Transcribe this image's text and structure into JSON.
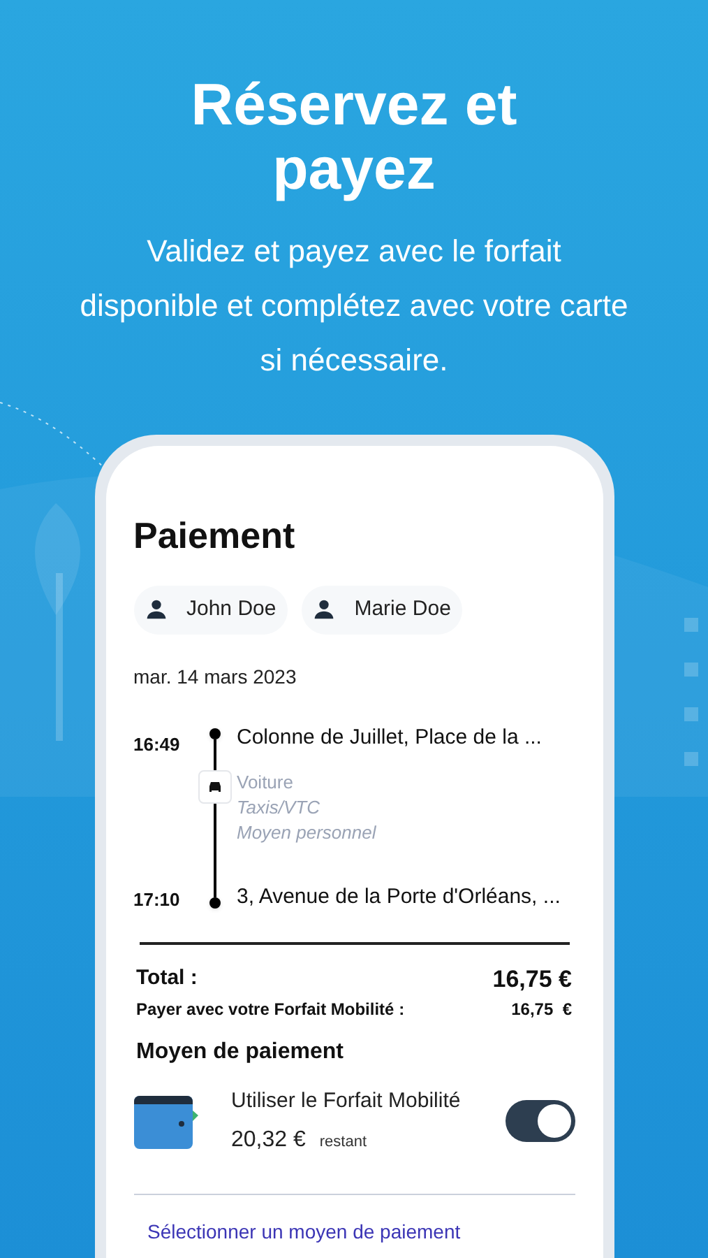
{
  "headline": "Réservez et payez",
  "subtitle": "Validez et payez avec le forfait disponible et complétez avec votre carte si nécessaire.",
  "screen": {
    "title": "Paiement",
    "passengers": [
      "John Doe",
      "Marie Doe"
    ],
    "date": "mar. 14 mars 2023",
    "trip": {
      "departure": {
        "time": "16:49",
        "place": "Colonne de Juillet, Place de la ..."
      },
      "modes": [
        "Voiture",
        "Taxis/VTC",
        "Moyen personnel"
      ],
      "arrival": {
        "time": "17:10",
        "place": "3, Avenue de la Porte d'Orléans, ..."
      }
    },
    "total": {
      "label": "Total :",
      "value": "16,75 €"
    },
    "forfait": {
      "label": "Payer avec votre Forfait Mobilité :",
      "value": "16,75  €"
    },
    "payment_heading": "Moyen de paiement",
    "wallet": {
      "label": "Utiliser le Forfait Mobilité",
      "amount": "20,32 €",
      "note": "restant",
      "on": true
    },
    "link": "Sélectionner un moyen de paiement"
  }
}
